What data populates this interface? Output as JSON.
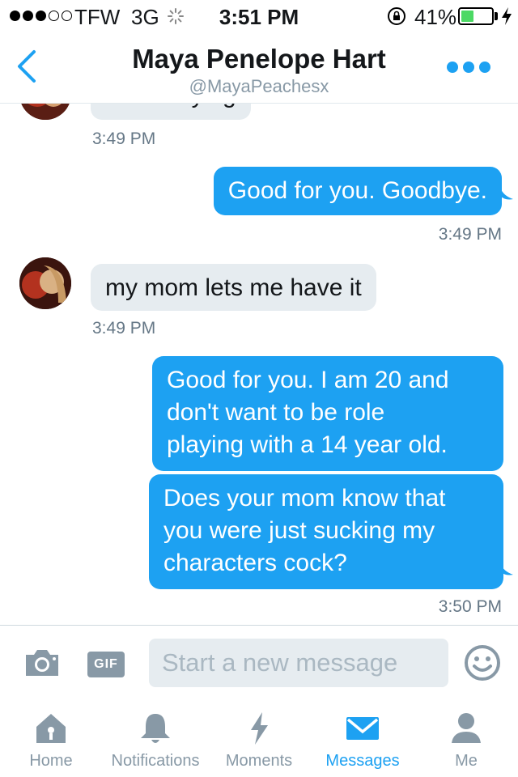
{
  "status_bar": {
    "carrier": "TFW",
    "network": "3G",
    "time": "3:51 PM",
    "battery_percent": "41%",
    "battery_level": 0.41,
    "signal_bars_filled": 3,
    "signal_bars_total": 5
  },
  "header": {
    "name": "Maya Penelope Hart",
    "handle": "@MayaPeachesx"
  },
  "messages": [
    {
      "from": "them",
      "text": "is still crying",
      "time": "3:49 PM"
    },
    {
      "from": "me",
      "text": "Good for you. Goodbye.",
      "time": "3:49 PM"
    },
    {
      "from": "them",
      "text": "my mom lets me have it",
      "time": "3:49 PM"
    },
    {
      "from": "me",
      "text": "Good for you. I am 20 and\ndon't want to be role\nplaying with a 14 year old."
    },
    {
      "from": "me",
      "text": "Does your mom know that\nyou were just sucking my\ncharacters cock?",
      "time": "3:50 PM"
    }
  ],
  "composer": {
    "placeholder": "Start a new message",
    "gif_label": "GIF",
    "camera_icon": "camera-icon",
    "emoji_icon": "smiley-icon"
  },
  "tabs": [
    {
      "label": "Home",
      "icon": "home-icon",
      "active": false
    },
    {
      "label": "Notifications",
      "icon": "bell-icon",
      "active": false
    },
    {
      "label": "Moments",
      "icon": "lightning-icon",
      "active": false
    },
    {
      "label": "Messages",
      "icon": "envelope-icon",
      "active": true
    },
    {
      "label": "Me",
      "icon": "person-icon",
      "active": false
    }
  ],
  "colors": {
    "accent": "#1da1f2",
    "incoming_bubble": "#e6ecf0",
    "muted_text": "#657786",
    "battery_fill": "#4cd964"
  }
}
